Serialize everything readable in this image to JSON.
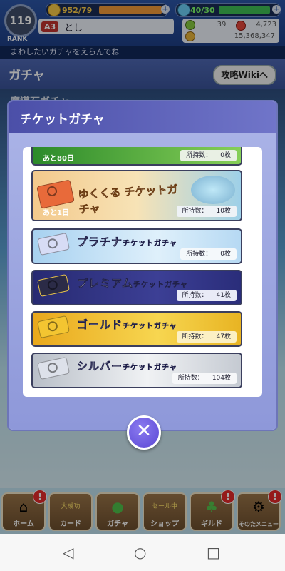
{
  "status": {
    "rank_value": "119",
    "rank_label": "RANK",
    "stamina": "952/79",
    "tickets": "40/30",
    "grade": "A3",
    "player_name": "とし",
    "stat_a": "39",
    "stat_b": "4,723",
    "coins": "15,368,347",
    "marquee": "まわしたいガチャをえらんでね"
  },
  "header": {
    "title": "ガチャ",
    "wiki_button": "攻略Wikiへ",
    "behind_label": "魔導石ガチャ"
  },
  "modal": {
    "title": "チケットガチャ",
    "count_label": "所持数：",
    "items": [
      {
        "name": "",
        "remain": "あと80日",
        "count": "0枚"
      },
      {
        "name": "ゆくくる チケットガチャ",
        "remain": "あと1日",
        "count": "10枚"
      },
      {
        "name": "プラチナ",
        "suffix": "チケットガチャ",
        "count": "0枚"
      },
      {
        "name": "プレミアム",
        "suffix": "チケットガチャ",
        "count": "41枚"
      },
      {
        "name": "ゴールド",
        "suffix": "チケットガチャ",
        "count": "47枚"
      },
      {
        "name": "シルバー",
        "suffix": "チケットガチャ",
        "count": "104枚"
      }
    ],
    "close_symbol": "✕"
  },
  "nav": [
    {
      "label": "ホーム",
      "badge": "!"
    },
    {
      "label": "カード",
      "tag": "大成功"
    },
    {
      "label": "ガチャ"
    },
    {
      "label": "ショップ",
      "tag": "セール中"
    },
    {
      "label": "ギルド",
      "badge": "!"
    },
    {
      "label": "そのたメニュー",
      "badge": "!"
    }
  ],
  "icons": {
    "back": "back-triangle-icon",
    "home": "home-circle-icon",
    "recents": "recents-square-icon"
  }
}
